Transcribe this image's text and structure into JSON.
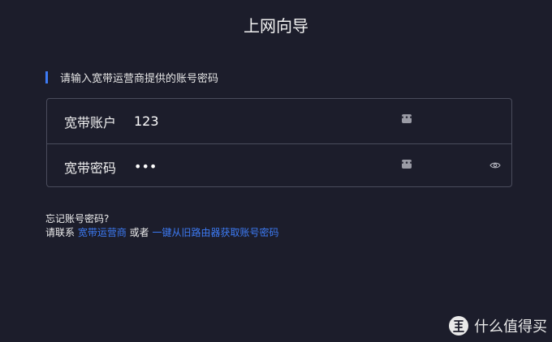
{
  "header": {
    "title": "上网向导"
  },
  "section": {
    "label": "请输入宽带运营商提供的账号密码"
  },
  "form": {
    "account": {
      "label": "宽带账户",
      "value": "123"
    },
    "password": {
      "label": "宽带密码",
      "value": "•••"
    }
  },
  "help": {
    "title": "忘记账号密码?",
    "prefix": "请联系 ",
    "link_isp": "宽带运营商",
    "middle": " 或者 ",
    "link_router": "一键从旧路由器获取账号密码"
  },
  "watermark": {
    "text": "什么值得买"
  },
  "colors": {
    "background": "#1c1d2b",
    "accent": "#3d7bf5",
    "border": "#4a4c5c"
  },
  "icons": {
    "autofill": "dots-icon",
    "reveal": "eye-icon",
    "watermark_logo": "zhi-logo-icon"
  }
}
